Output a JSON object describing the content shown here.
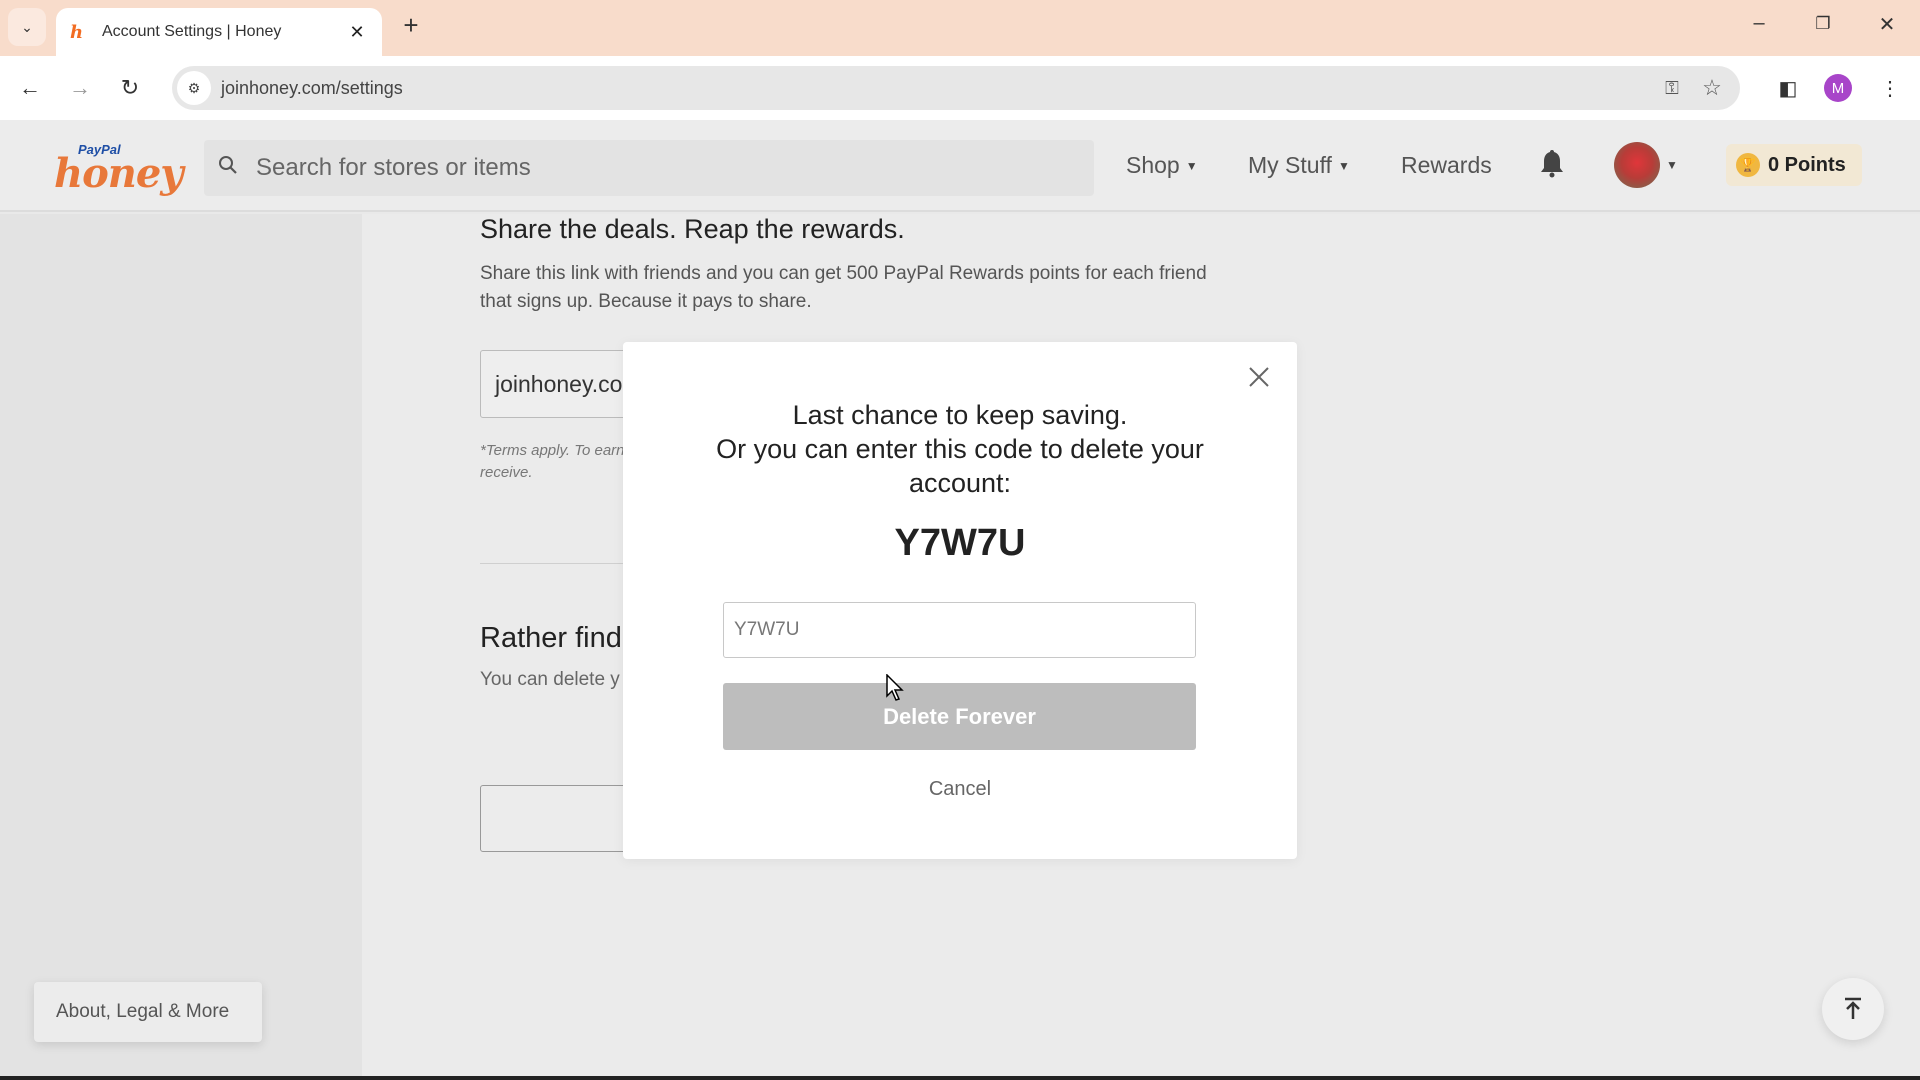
{
  "browser": {
    "tab_title": "Account Settings | Honey",
    "tab_favicon": "h",
    "url": "joinhoney.com/settings",
    "profile_initial": "M",
    "icons": {
      "tab_search": "chevron-down",
      "tab_close": "✕",
      "new_tab": "+",
      "minimize": "–",
      "restore": "❐",
      "close": "✕",
      "back": "←",
      "forward": "→",
      "reload": "↻",
      "site_info": "⚙",
      "password_key": "⚿",
      "bookmark_star": "☆",
      "side_panel": "◧",
      "menu": "⋮"
    }
  },
  "header": {
    "logo_paypal": "PayPal",
    "logo_honey": "honey",
    "search_placeholder": "Search for stores or items",
    "nav": {
      "shop": "Shop",
      "my_stuff": "My Stuff",
      "rewards": "Rewards"
    },
    "points": "0 Points"
  },
  "page": {
    "share_heading": "Share the deals. Reap the rewards.",
    "share_body": "Share this link with friends and you can get 500 PayPal Rewards points for each friend that signs up. Because it pays to share.",
    "referral_link": "joinhoney.co",
    "terms": "*Terms apply. To earn points on a qualifyin receive.",
    "delete_heading": "Rather find",
    "delete_body": "You can delete y respect your ch once you decide",
    "footer_link": "About, Legal & More"
  },
  "modal": {
    "line1": "Last chance to keep saving.",
    "line2": "Or you can enter this code to delete your account:",
    "code": "Y7W7U",
    "input_value": "Y7W7U",
    "delete_button": "Delete Forever",
    "cancel": "Cancel"
  }
}
